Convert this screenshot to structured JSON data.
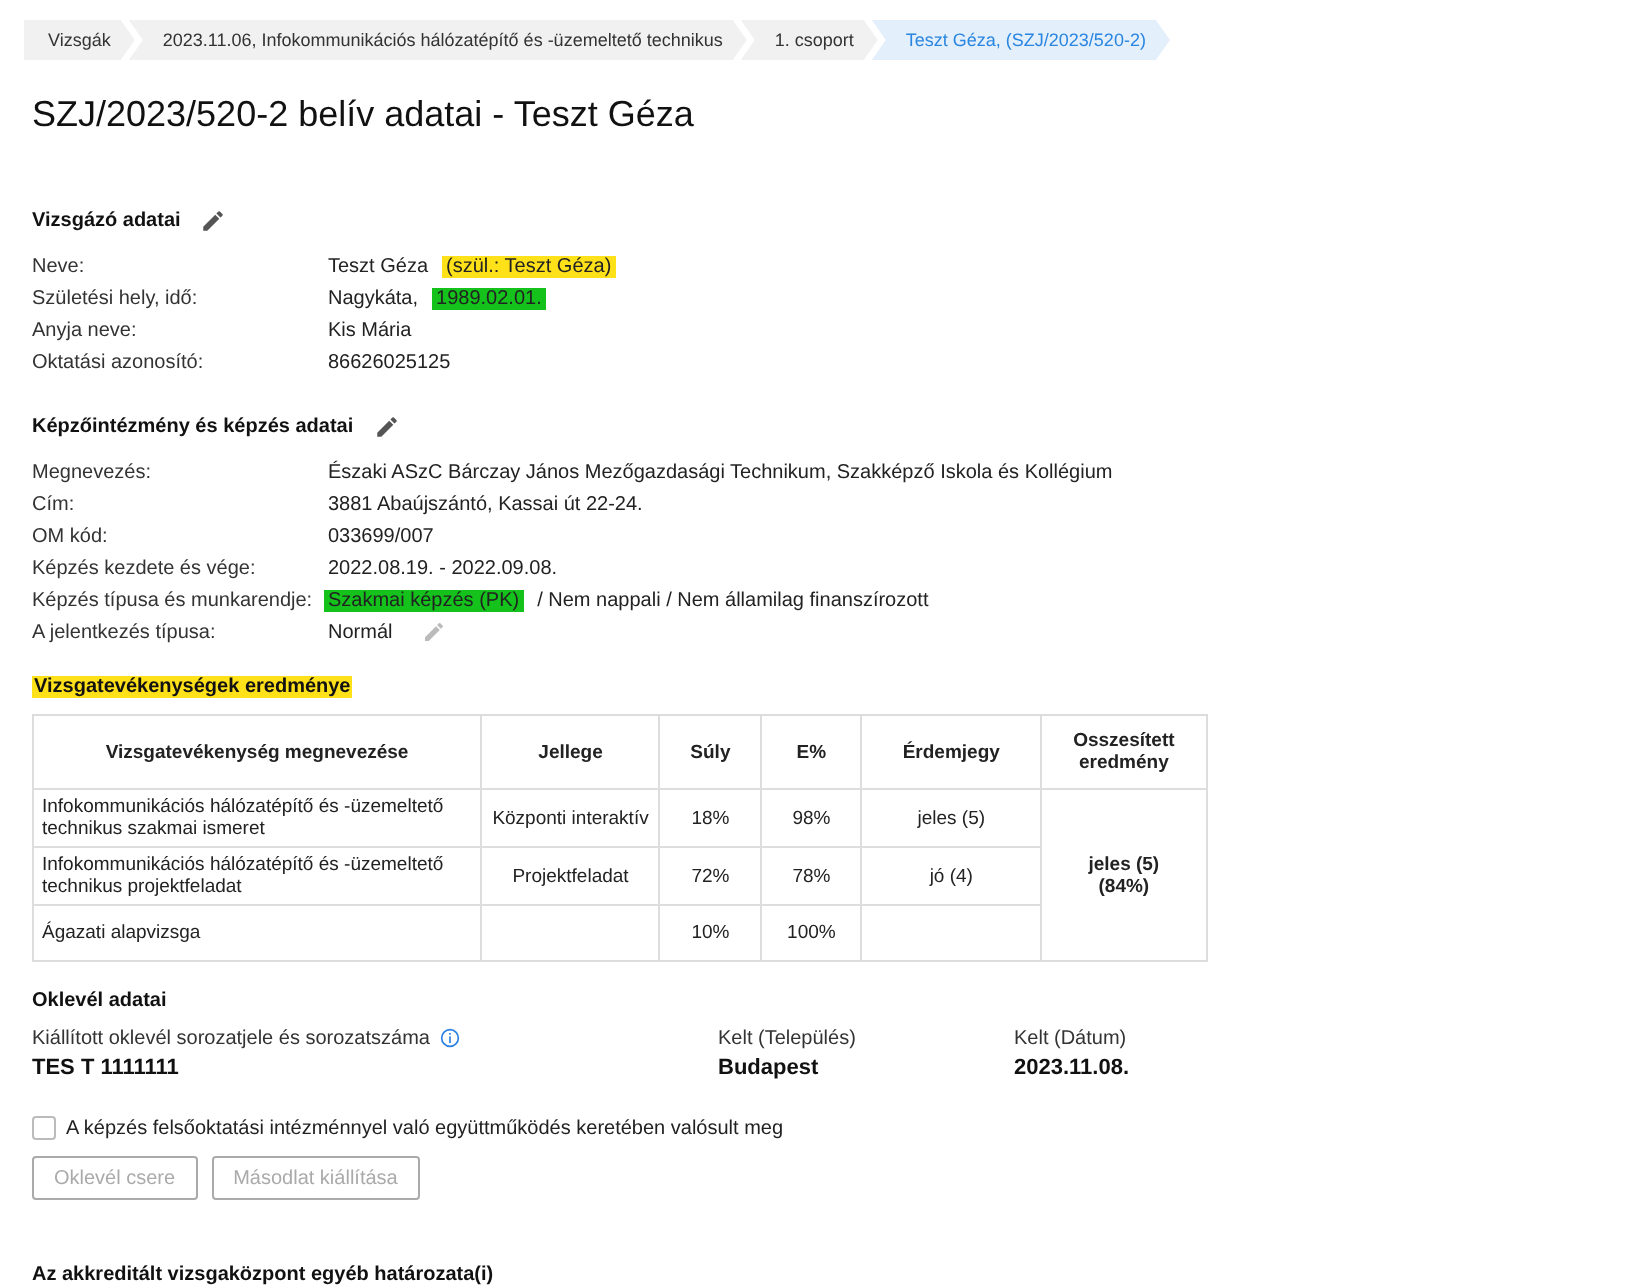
{
  "breadcrumb": [
    {
      "label": "Vizsgák",
      "selected": false
    },
    {
      "label": "2023.11.06, Infokommunikációs hálózatépítő és -üzemeltető technikus",
      "selected": false
    },
    {
      "label": "1. csoport",
      "selected": false
    },
    {
      "label": "Teszt Géza, (SZJ/2023/520-2)",
      "selected": true
    }
  ],
  "title": "SZJ/2023/520-2 belív adatai - Teszt Géza",
  "sections": [
    {
      "heading": "Vizsgázó adatai",
      "editable": true,
      "rows": [
        {
          "label": "Neve:",
          "parts": [
            {
              "text": "Teszt Géza"
            },
            {
              "text": "(szül.: Teszt Géza)",
              "color": "#ffe11a"
            }
          ]
        },
        {
          "label": "Születési hely, idő:",
          "parts": [
            {
              "text": "Nagykáta,"
            },
            {
              "text": "1989.02.01.",
              "color": "#14c21b"
            }
          ]
        },
        {
          "label": "Anyja neve:",
          "parts": [
            {
              "text": "Kis Mária"
            }
          ]
        },
        {
          "label": "Oktatási azonosító:",
          "parts": [
            {
              "text": "86626025125"
            }
          ]
        }
      ]
    },
    {
      "heading": "Képzőintézmény és képzés adatai",
      "editable": true,
      "rows": [
        {
          "label": "Megnevezés:",
          "parts": [
            {
              "text": "Északi ASzC Bárczay János Mezőgazdasági Technikum, Szakképző Iskola és Kollégium"
            }
          ]
        },
        {
          "label": "Cím:",
          "parts": [
            {
              "text": "3881 Abaújszántó, Kassai út 22-24."
            }
          ]
        },
        {
          "label": "OM kód:",
          "parts": [
            {
              "text": "033699/007"
            }
          ]
        },
        {
          "label": "Képzés kezdete és vége:",
          "parts": [
            {
              "text": "2022.08.19. - 2022.09.08."
            }
          ]
        },
        {
          "label": "Képzés típusa és munkarendje:",
          "parts": [
            {
              "text": "Szakmai képzés (PK)",
              "color": "#14c21b"
            },
            {
              "text": "/ Nem nappali / Nem államilag finanszírozott"
            }
          ]
        },
        {
          "label": "A jelentkezés típusa:",
          "parts": [
            {
              "text": "Normál"
            }
          ],
          "edit_disabled": true
        }
      ]
    }
  ],
  "results": {
    "heading": {
      "text": "Vizsgatevékenységek eredménye",
      "color": "#ffe11a"
    },
    "columns": [
      "Vizsgatevékenység megnevezése",
      "Jellege",
      "Súly",
      "E%",
      "Érdemjegy",
      "Osszesített eredmény"
    ],
    "rows": [
      [
        "Infokommunikációs hálózatépítő és -üzemeltető technikus szakmai ismeret",
        "Központi interaktív",
        "18%",
        "98%",
        "jeles (5)"
      ],
      [
        "Infokommunikációs hálózatépítő és -üzemeltető technikus projektfeladat",
        "Projektfeladat",
        "72%",
        "78%",
        "jó (4)"
      ],
      [
        "Ágazati alapvizsga",
        "",
        "10%",
        "100%",
        ""
      ]
    ],
    "total": "jeles (5) (84%)"
  },
  "diploma": {
    "heading": "Oklevél adatai",
    "fields": [
      {
        "label": "Kiállított oklevél sorozatjele és sorozatszáma",
        "value": "TES T 1111111",
        "info": true
      },
      {
        "label": "Kelt (Település)",
        "value": "Budapest",
        "info": false
      },
      {
        "label": "Kelt (Dátum)",
        "value": "2023.11.08.",
        "info": false
      }
    ],
    "checkbox": {
      "label": "A képzés felsőoktatási intézménnyel való együttműködés keretében valósult meg",
      "checked": false
    },
    "buttons": [
      {
        "label": "Oklevél csere",
        "disabled": true
      },
      {
        "label": "Másodlat kiállítása",
        "disabled": true
      }
    ]
  },
  "footer_heading": "Az akkreditált vizsgaközpont egyéb határozata(i)"
}
